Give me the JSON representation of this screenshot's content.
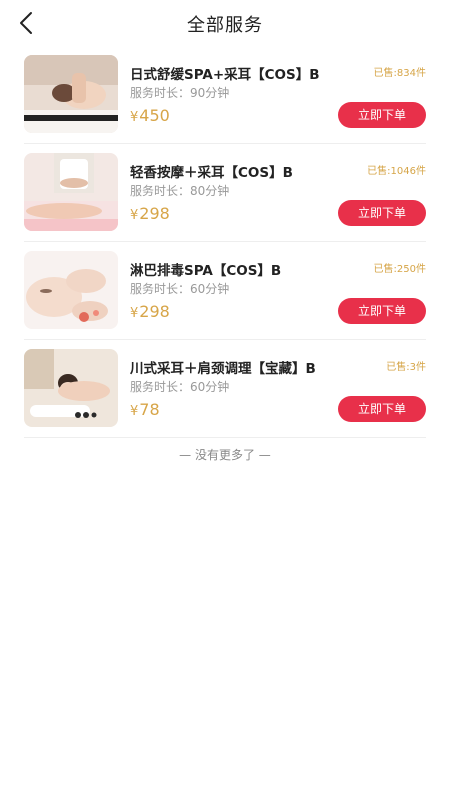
{
  "header": {
    "title": "全部服务",
    "back_icon": "chevron-left-icon"
  },
  "colors": {
    "accent": "#e8304a",
    "price": "#d7a548",
    "sold": "#d6a548"
  },
  "services": [
    {
      "name": "日式舒缓SPA+采耳【COS】B",
      "sold": "已售:834件",
      "duration": "服务时长：90分钟",
      "price": "450",
      "button": "立即下单"
    },
    {
      "name": "轻香按摩＋采耳【COS】B",
      "sold": "已售:1046件",
      "duration": "服务时长：80分钟",
      "price": "298",
      "button": "立即下单"
    },
    {
      "name": "淋巴排毒SPA【COS】B",
      "sold": "已售:250件",
      "duration": "服务时长：60分钟",
      "price": "298",
      "button": "立即下单"
    },
    {
      "name": "川式采耳＋肩颈调理【宝藏】B",
      "sold": "已售:3件",
      "duration": "服务时长：60分钟",
      "price": "78",
      "button": "立即下单"
    }
  ],
  "currency": "¥",
  "footer": {
    "no_more": "— 没有更多了 —"
  }
}
